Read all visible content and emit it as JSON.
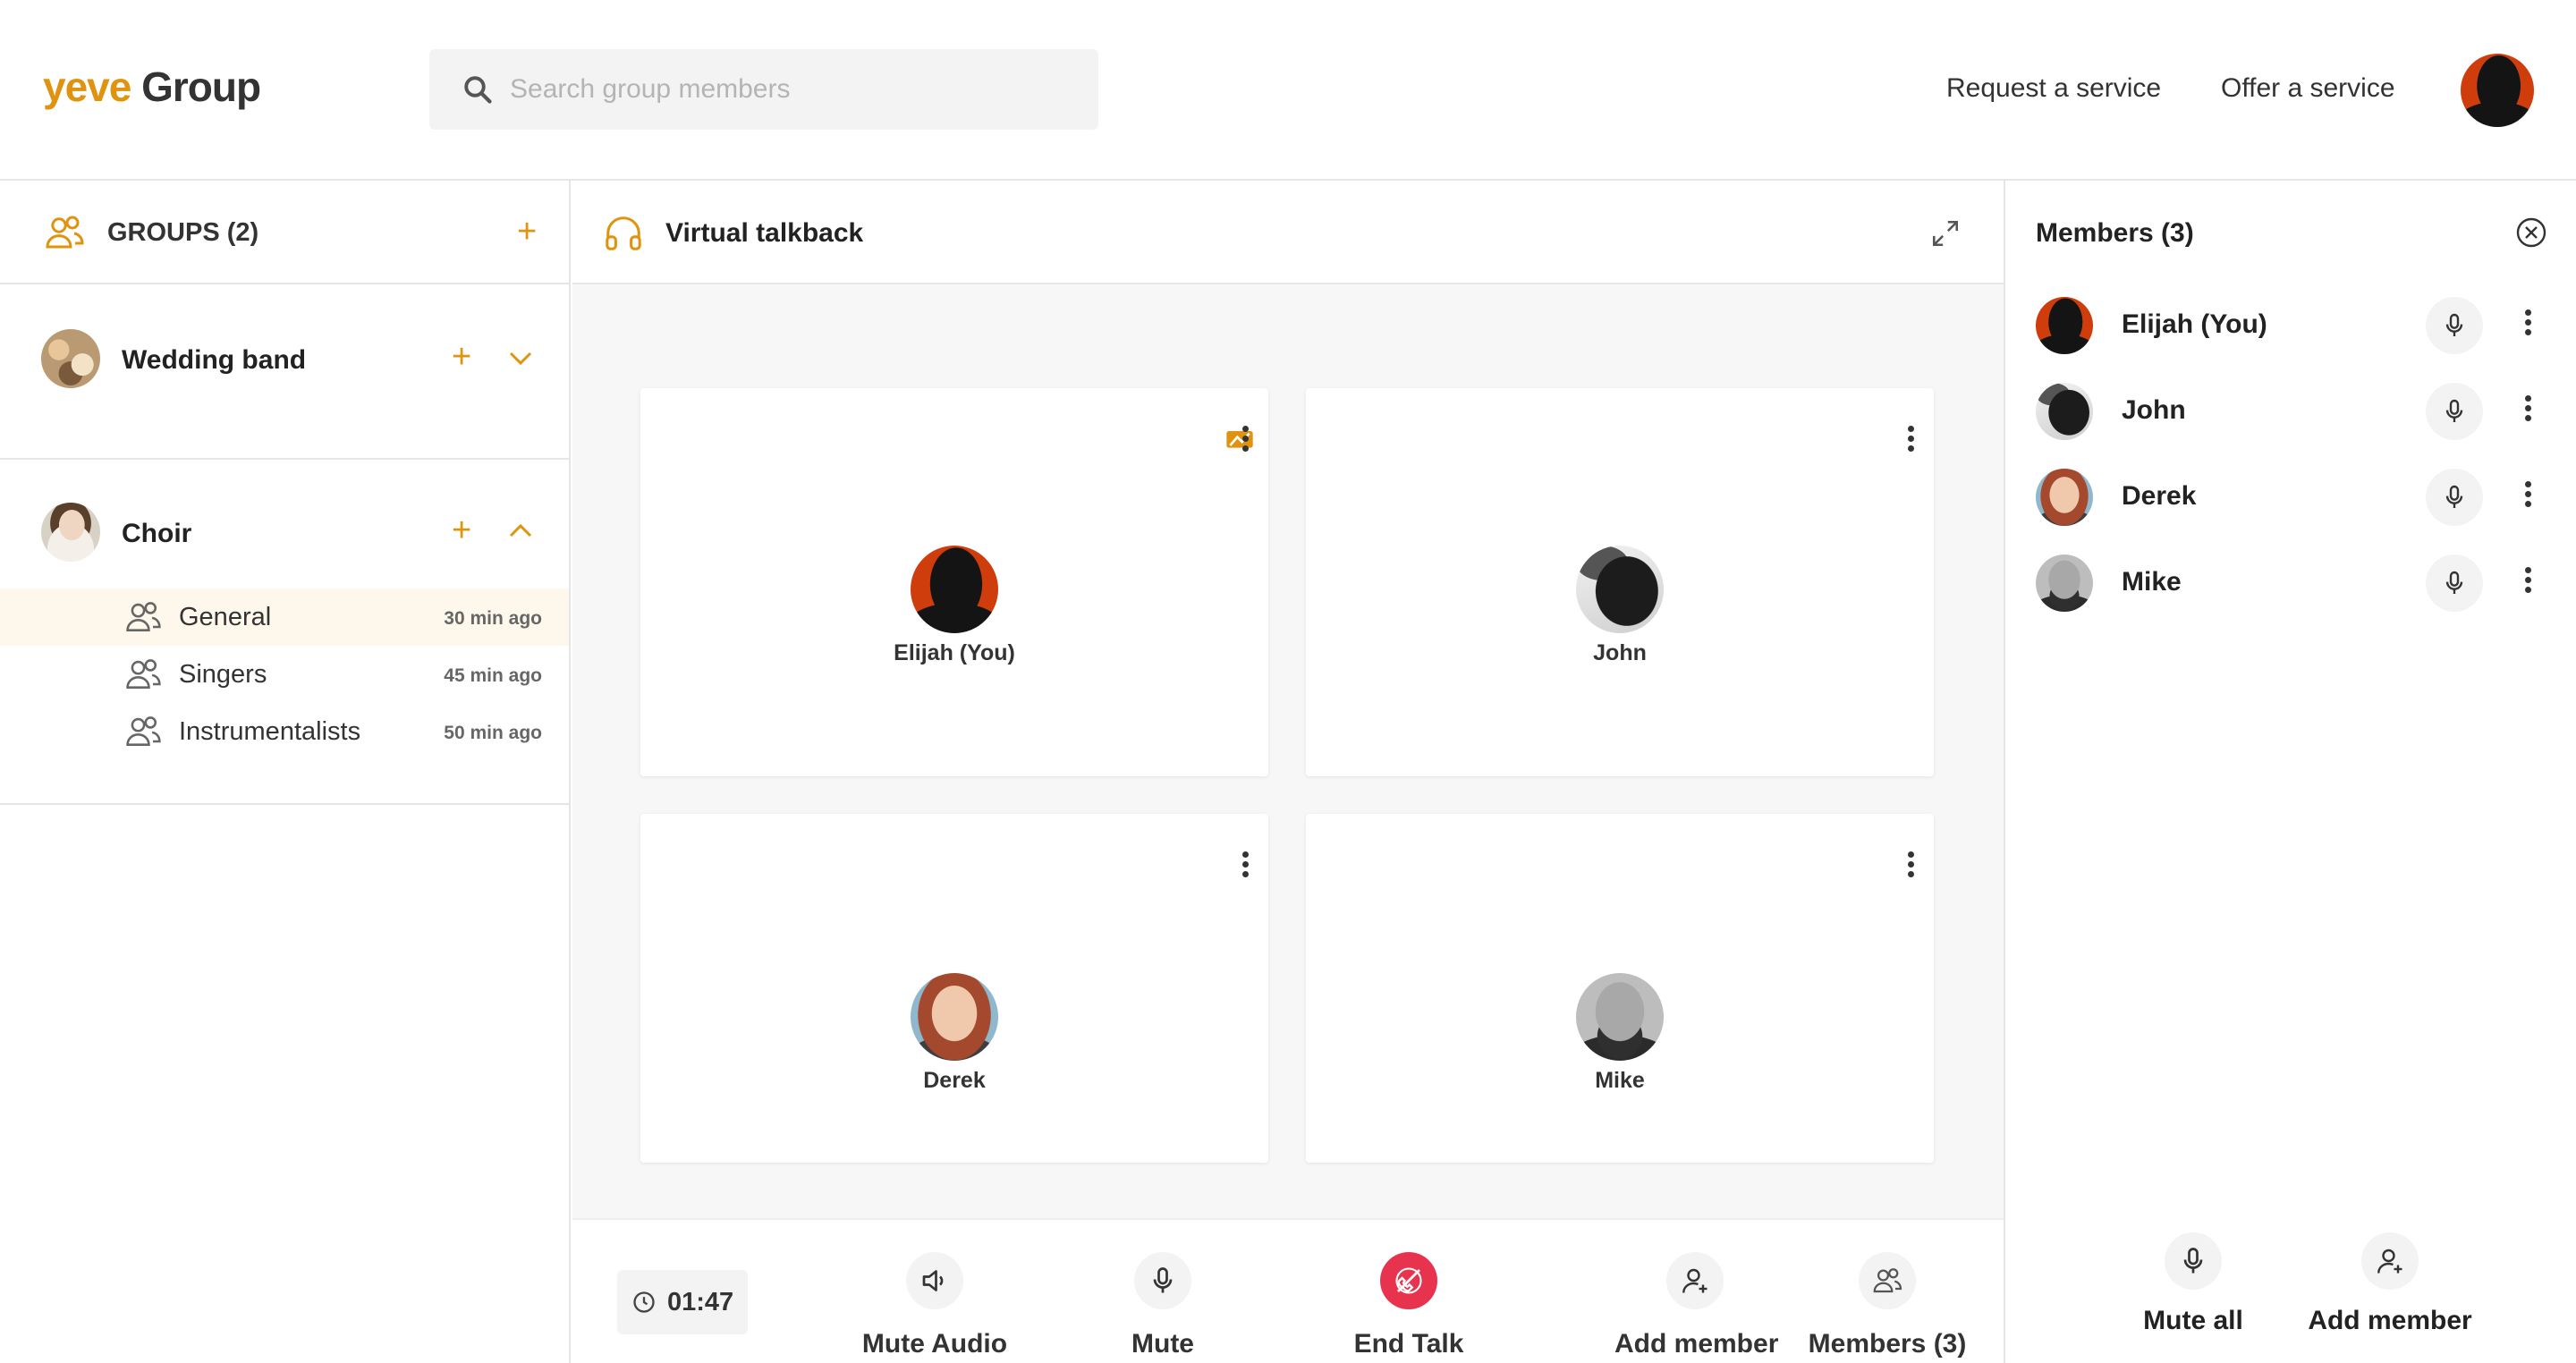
{
  "header": {
    "logo_brand": "yeve",
    "logo_suffix": "Group",
    "search_placeholder": "Search group members",
    "links": [
      "Request a service",
      "Offer a service"
    ]
  },
  "sidebar": {
    "title": "GROUPS (2)",
    "groups": [
      {
        "name": "Wedding band",
        "expanded": false,
        "subgroups": []
      },
      {
        "name": "Choir",
        "expanded": true,
        "subgroups": [
          {
            "label": "General",
            "time": "30 min ago",
            "active": true
          },
          {
            "label": "Singers",
            "time": "45 min ago",
            "active": false
          },
          {
            "label": "Instrumentalists",
            "time": "50 min ago",
            "active": false
          }
        ]
      }
    ]
  },
  "call": {
    "title": "Virtual talkback",
    "tiles": [
      {
        "name": "Elijah (You)",
        "speaking": true
      },
      {
        "name": "John",
        "speaking": false
      },
      {
        "name": "Derek",
        "speaking": false
      },
      {
        "name": "Mike",
        "speaking": false
      }
    ],
    "timer": "01:47",
    "controls": [
      "Mute Audio",
      "Mute",
      "End Talk",
      "Add member",
      "Members (3)"
    ]
  },
  "members_panel": {
    "title": "Members (3)",
    "members": [
      "Elijah (You)",
      "John",
      "Derek",
      "Mike"
    ],
    "actions": [
      "Mute all",
      "Add member"
    ]
  },
  "colors": {
    "accent": "#e0930f",
    "end_talk": "#e8334f",
    "panel_bg": "#f7f7f7"
  }
}
